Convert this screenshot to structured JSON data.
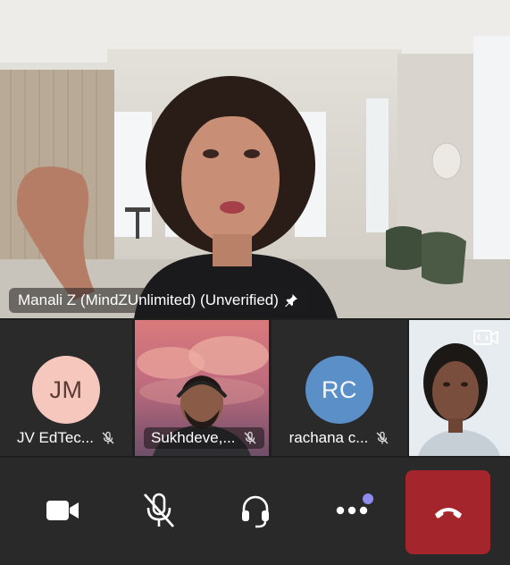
{
  "main_video": {
    "participant_label": "Manali Z (MindZUnlimited) (Unverified)",
    "pinned": true
  },
  "participants": [
    {
      "initials": "JM",
      "name": "JV EdTec...",
      "muted": true,
      "avatar_color": "#f6c8bd"
    },
    {
      "name": "Sukhdeve,...",
      "muted": true,
      "video": true
    },
    {
      "initials": "RC",
      "name": "rachana c...",
      "muted": true,
      "avatar_color": "#5b8fc8"
    },
    {
      "self_view": true,
      "video": true
    }
  ],
  "controls": {
    "video": "camera-icon",
    "mic": "mic-off-icon",
    "audio": "headset-icon",
    "more": "more-options-icon",
    "more_has_badge": true,
    "hangup": "end-call-icon",
    "hangup_color": "#a4262c"
  }
}
